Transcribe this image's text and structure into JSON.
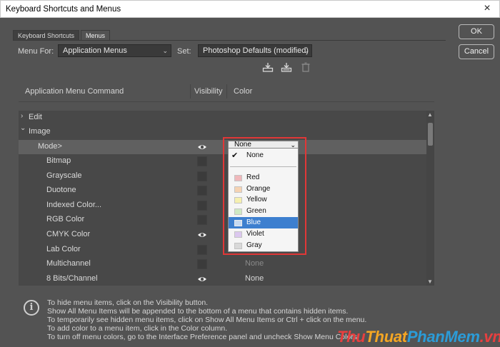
{
  "window": {
    "title": "Keyboard Shortcuts and Menus",
    "close_glyph": "×"
  },
  "tabs": [
    {
      "label": "Keyboard Shortcuts",
      "active": false
    },
    {
      "label": "Menus",
      "active": true
    }
  ],
  "menu_for": {
    "label": "Menu For:",
    "value": "Application Menus"
  },
  "set": {
    "label": "Set:",
    "value": "Photoshop Defaults (modified)"
  },
  "toolbar_icons": [
    "save-set-icon",
    "save-set-as-icon",
    "delete-set-icon"
  ],
  "columns": {
    "command": "Application Menu Command",
    "visibility": "Visibility",
    "color": "Color"
  },
  "rows": [
    {
      "name": "Edit",
      "indent": 0,
      "arrow": "›",
      "visible": null,
      "color": ""
    },
    {
      "name": "Image",
      "indent": 0,
      "arrow": "⌄",
      "visible": null,
      "color": ""
    },
    {
      "name": "Mode>",
      "indent": 1,
      "arrow": "",
      "visible": true,
      "color": "None",
      "selected": true
    },
    {
      "name": "Bitmap",
      "indent": 2,
      "arrow": "",
      "visible": false,
      "color": ""
    },
    {
      "name": "Grayscale",
      "indent": 2,
      "arrow": "",
      "visible": false,
      "color": ""
    },
    {
      "name": "Duotone",
      "indent": 2,
      "arrow": "",
      "visible": false,
      "color": ""
    },
    {
      "name": "Indexed Color...",
      "indent": 2,
      "arrow": "",
      "visible": false,
      "color": ""
    },
    {
      "name": "RGB Color",
      "indent": 2,
      "arrow": "",
      "visible": false,
      "color": ""
    },
    {
      "name": "CMYK Color",
      "indent": 2,
      "arrow": "",
      "visible": true,
      "color": ""
    },
    {
      "name": "Lab Color",
      "indent": 2,
      "arrow": "",
      "visible": false,
      "color": ""
    },
    {
      "name": "Multichannel",
      "indent": 2,
      "arrow": "",
      "visible": false,
      "color": "None"
    },
    {
      "name": "8 Bits/Channel",
      "indent": 2,
      "arrow": "",
      "visible": true,
      "color": "None"
    }
  ],
  "color_dropdown": {
    "selected": "None",
    "options": [
      {
        "label": "None",
        "checked": true,
        "swatch": null
      },
      {
        "label": "Red",
        "swatch": "#f0b8bb"
      },
      {
        "label": "Orange",
        "swatch": "#f5d3b3"
      },
      {
        "label": "Yellow",
        "swatch": "#f5f0b0"
      },
      {
        "label": "Green",
        "swatch": "#cfe9c3"
      },
      {
        "label": "Blue",
        "swatch": "#c6daf2",
        "highlighted": true
      },
      {
        "label": "Violet",
        "swatch": "#dcc8ef"
      },
      {
        "label": "Gray",
        "swatch": "#d9d9d9"
      }
    ]
  },
  "buttons": {
    "ok": "OK",
    "cancel": "Cancel"
  },
  "hints": [
    "To hide menu items, click on the Visibility button.",
    "Show All Menu Items will be appended to the bottom of a menu that contains hidden items.",
    "To temporarily see hidden menu items, click on Show All Menu Items or Ctrl + click on the menu.",
    "To add color to a menu item, click in the Color column.",
    "To turn off menu colors, go to the Interface Preference panel and uncheck Show Menu Colors."
  ],
  "watermark": {
    "part1": "Thu",
    "part2": "Thuat",
    "part3": "PhanMem",
    "part4": ".vn"
  },
  "colors": {
    "dialog_bg": "#535353",
    "list_bg": "#484848",
    "highlight": "#3d7fcf",
    "outline_red": "#e13737"
  }
}
